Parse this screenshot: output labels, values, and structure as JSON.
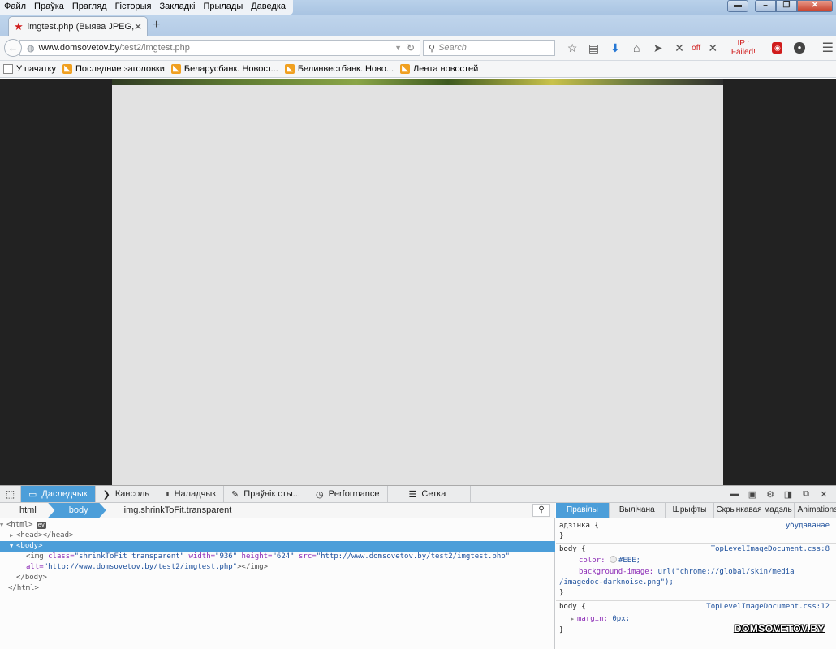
{
  "menu": [
    "Файл",
    "Праўка",
    "Прагляд",
    "Гісторыя",
    "Закладкі",
    "Прылады",
    "Даведка"
  ],
  "window": {
    "close_icon": "✕",
    "max_icon": "❐",
    "min_icon": "–"
  },
  "tab": {
    "title": "imgtest.php (Выява JPEG, ...",
    "close": "✕",
    "new": "+"
  },
  "url": {
    "host": "www.domsovetov.by",
    "path": "/test2/imgtest.php"
  },
  "search": {
    "placeholder": "Search"
  },
  "toolbar": {
    "off_label": "off",
    "ip_label": "IP : Failed!"
  },
  "bookmarks": [
    {
      "label": "У пачатку",
      "icon": "folder"
    },
    {
      "label": "Последние заголовки",
      "icon": "rss"
    },
    {
      "label": "Беларусбанк. Новост...",
      "icon": "rss"
    },
    {
      "label": "Белинвестбанк. Ново...",
      "icon": "rss"
    },
    {
      "label": "Лента новостей",
      "icon": "rss"
    }
  ],
  "devtools": {
    "tabs": [
      "Даследчык",
      "Кансоль",
      "Наладчык",
      "Праўнік сты...",
      "Performance",
      "Сетка"
    ],
    "breadcrumbs": [
      "html",
      "body",
      "img.shrinkToFit.transparent"
    ],
    "markup": {
      "html_open": "<html>",
      "event_badge": "ev",
      "head": "<head></head>",
      "body_open": "<body>",
      "img_open": "<img",
      "img_class_attr": "class=",
      "img_class_val": "\"shrinkToFit transparent\"",
      "img_width_attr": "width=",
      "img_width_val": "\"936\"",
      "img_height_attr": "height=",
      "img_height_val": "\"624\"",
      "img_src_attr": "src=",
      "img_src_val": "\"http://www.domsovetov.by/test2/imgtest.php\"",
      "img_alt_attr": "alt=",
      "img_alt_val": "\"http://www.domsovetov.by/test2/imgtest.php\"",
      "img_close": "></img>",
      "body_close": "</body>",
      "html_close": "</html>"
    },
    "rules_tabs": [
      "Правілы",
      "Вылічана",
      "Шрыфты",
      "Скрынкавая мадэль",
      "Animations"
    ],
    "rules": {
      "element_selector": "адзінка {",
      "element_source": "убудаванае",
      "close_brace": "}",
      "rule1_selector": "body {",
      "rule1_source": "TopLevelImageDocument.css:8",
      "color_prop": "color:",
      "color_val": "#EEE;",
      "bg_prop": "background-image:",
      "bg_val_1": "url(\"chrome://global/skin/media",
      "bg_val_2": "/imagedoc-darknoise.png\");",
      "rule2_selector": "body {",
      "rule2_source": "TopLevelImageDocument.css:12",
      "margin_prop": "margin:",
      "margin_val": "0px;"
    }
  },
  "watermark": "DOMSOVETOV.BY"
}
